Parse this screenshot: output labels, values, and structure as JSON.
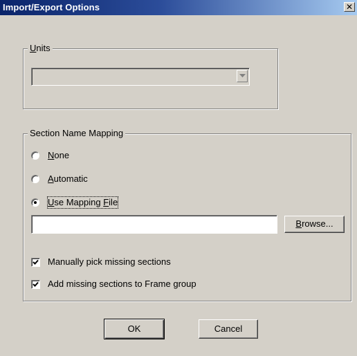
{
  "window": {
    "title": "Import/Export Options",
    "close_glyph": "✕"
  },
  "units": {
    "legend_first": "U",
    "legend_rest": "nits",
    "combo_value": "",
    "combo_enabled": false
  },
  "section_mapping": {
    "legend": "Section Name Mapping",
    "options": [
      {
        "first": "N",
        "rest": "one",
        "selected": false
      },
      {
        "first": "A",
        "rest": "utomatic",
        "selected": false
      },
      {
        "first": "U",
        "mid": "se Mapping ",
        "ul2": "F",
        "rest": "ile",
        "selected": true
      }
    ],
    "mapping_file_value": "",
    "browse_first": "B",
    "browse_rest": "rowse..."
  },
  "checkboxes": {
    "manual_pick_label": "Manually pick missing sections",
    "manual_pick_checked": true,
    "add_missing_label": "Add missing sections to Frame group",
    "add_missing_checked": true
  },
  "buttons": {
    "ok": "OK",
    "cancel": "Cancel"
  },
  "icons": {
    "close": "close-icon",
    "combo_arrow": "chevron-down-icon",
    "check": "checkmark-icon"
  }
}
